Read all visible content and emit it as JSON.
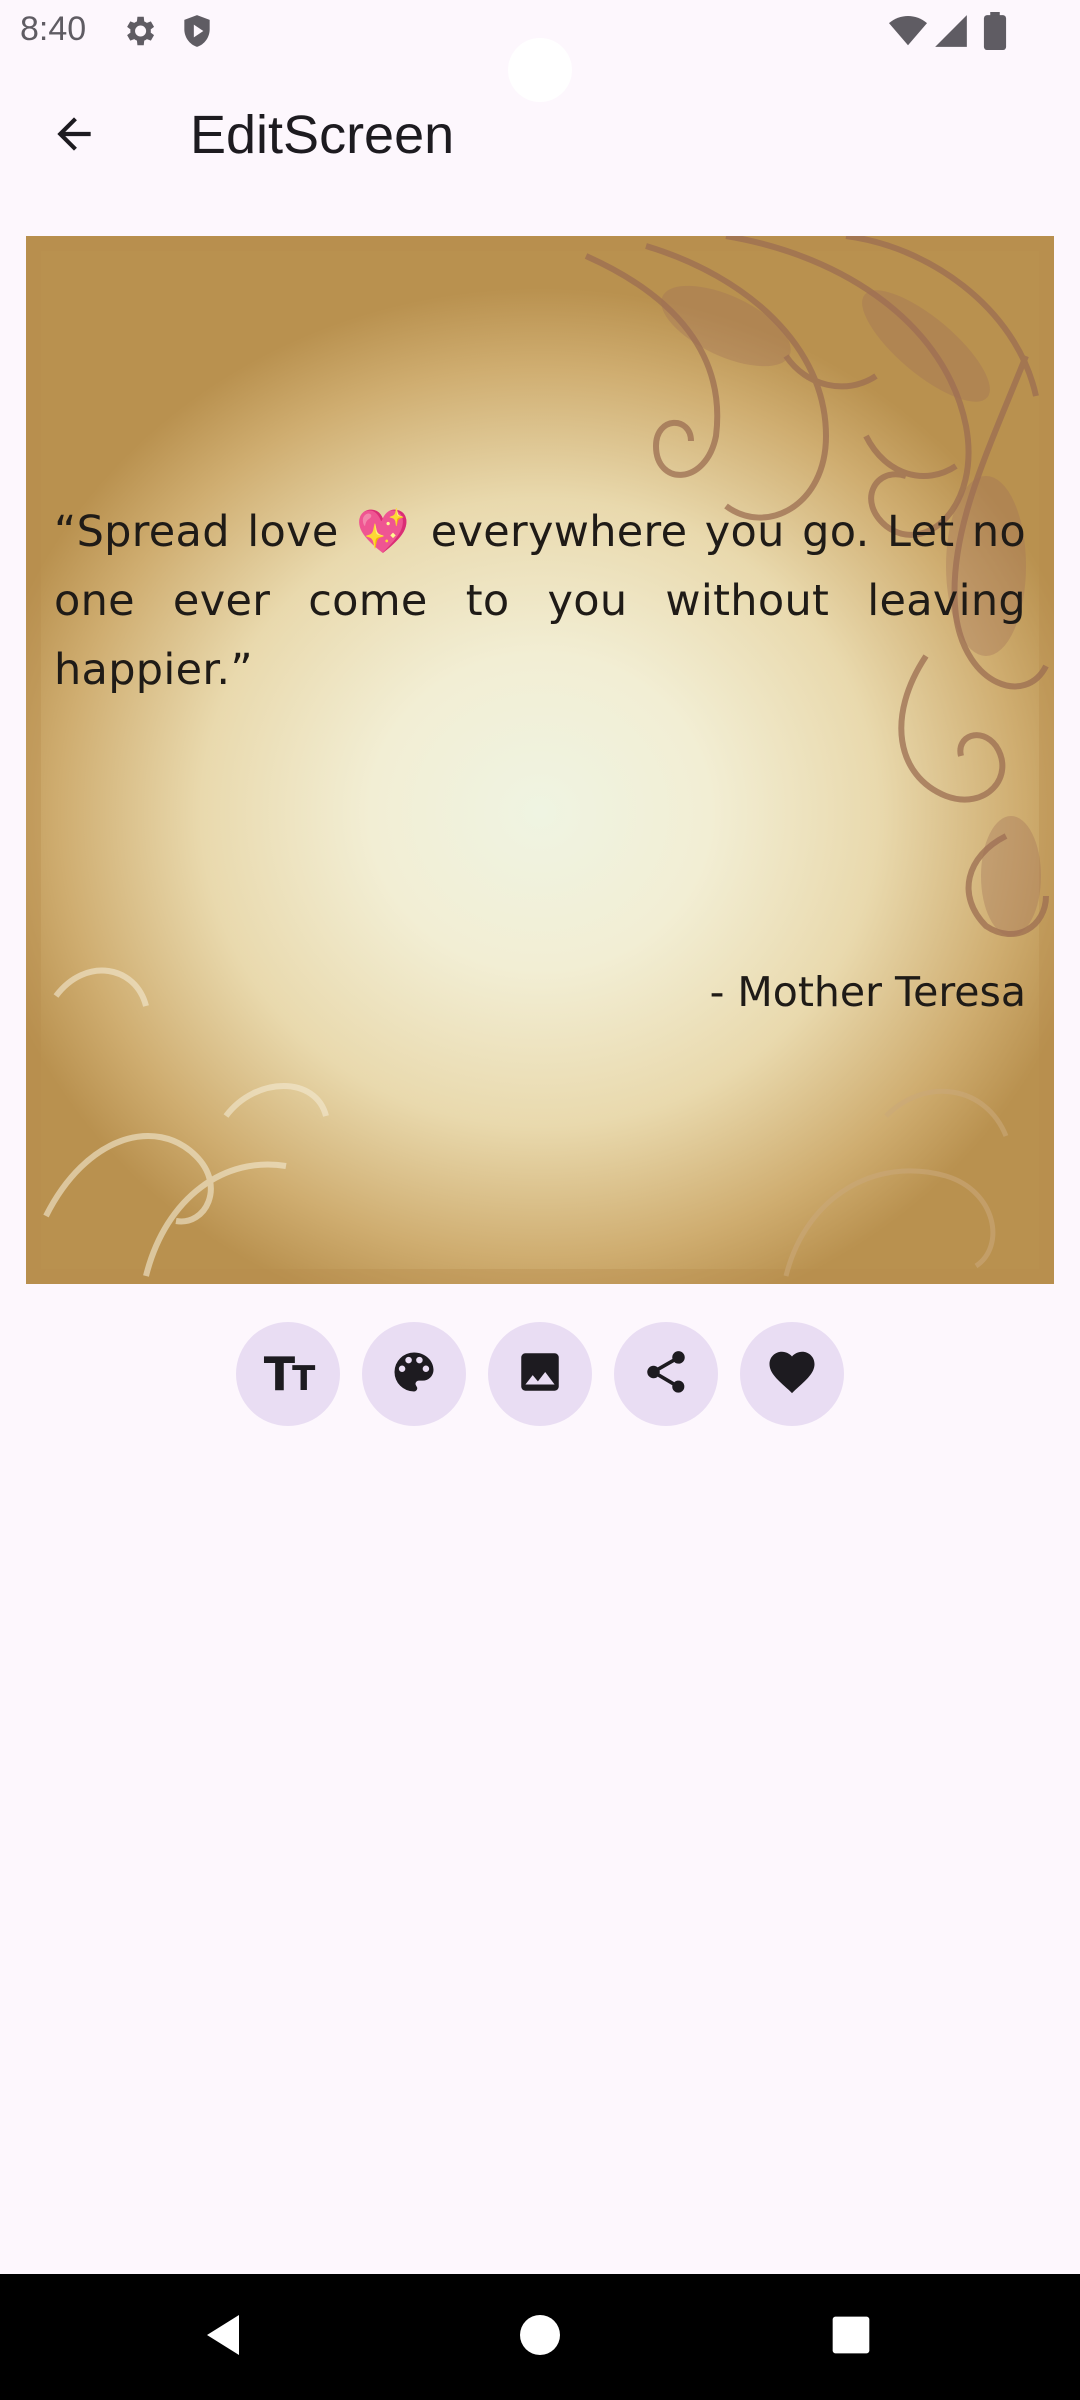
{
  "status_bar": {
    "time": "8:40",
    "icons": [
      "settings-gear-icon",
      "shield-icon",
      "wifi-icon",
      "signal-icon",
      "battery-icon"
    ]
  },
  "app_bar": {
    "title": "EditScreen",
    "back_icon": "arrow-back-icon"
  },
  "quote": {
    "text": "“Spread love 💖 everywhere you go. Let no one ever come to you without leaving happier.”",
    "author": "- Mother Teresa"
  },
  "toolbar": {
    "font_label": "T",
    "font_label_small": "T",
    "buttons": [
      "text-format-icon",
      "palette-icon",
      "image-icon",
      "share-icon",
      "heart-icon"
    ]
  },
  "nav_bar": {
    "buttons": [
      "back-triangle-icon",
      "home-circle-icon",
      "recents-square-icon"
    ]
  },
  "colors": {
    "background": "#fdf7fd",
    "tool_button_bg": "#e9ddf3",
    "text": "#1d1b20"
  }
}
